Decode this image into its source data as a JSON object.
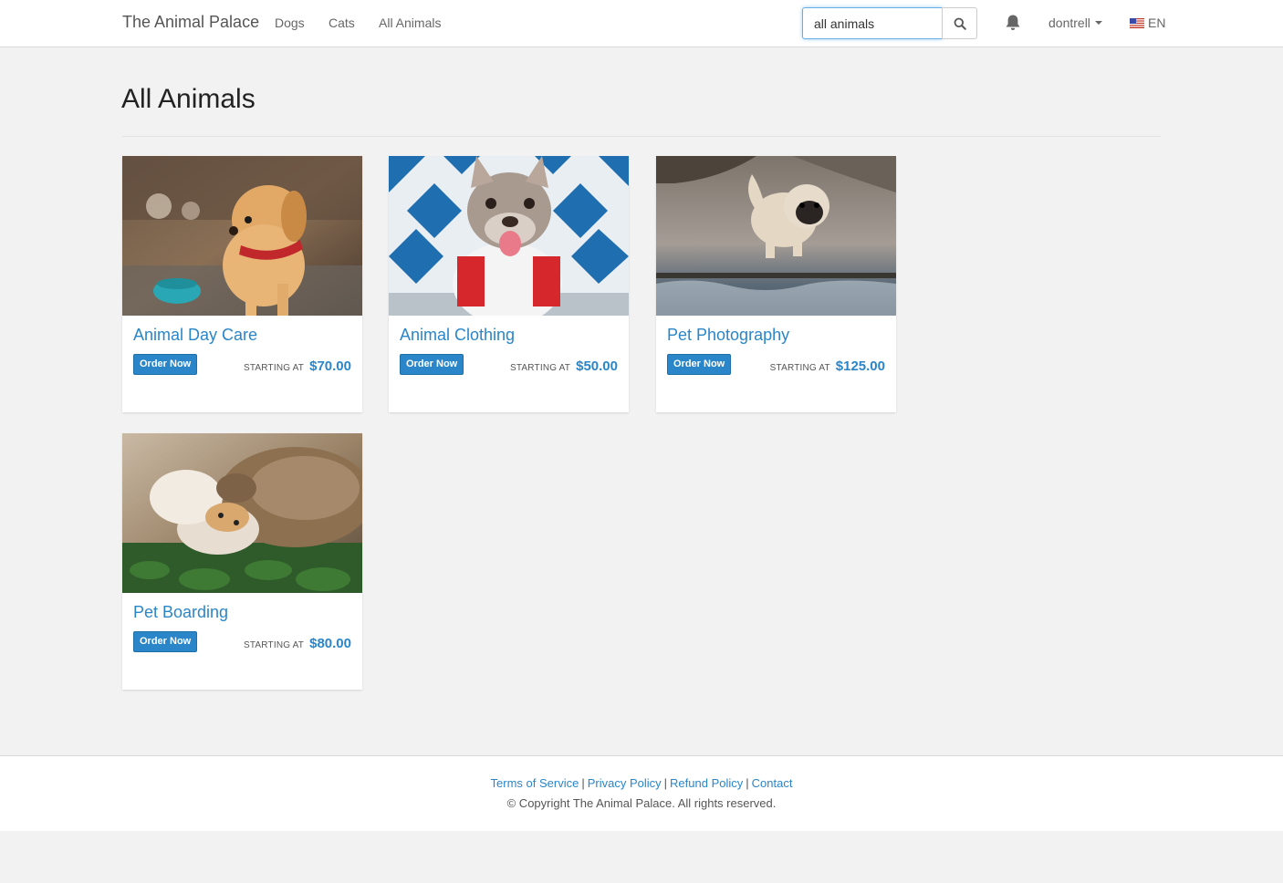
{
  "navbar": {
    "brand": "The Animal Palace",
    "links": [
      {
        "label": "Dogs"
      },
      {
        "label": "Cats"
      },
      {
        "label": "All Animals"
      }
    ],
    "search": {
      "value": "all animals",
      "icon": "search-icon"
    },
    "notifications_icon": "bell-icon",
    "user": {
      "name": "dontrell"
    },
    "language": {
      "code": "EN",
      "icon": "us-flag-icon"
    }
  },
  "main": {
    "title": "All Animals",
    "products": [
      {
        "name": "Animal Day Care",
        "button": "Order Now",
        "starting_label": "STARTING AT",
        "price": "$70.00",
        "image": "puppy-photo"
      },
      {
        "name": "Animal Clothing",
        "button": "Order Now",
        "starting_label": "STARTING AT",
        "price": "$50.00",
        "image": "bulldog-shirt-photo"
      },
      {
        "name": "Pet Photography",
        "button": "Order Now",
        "starting_label": "STARTING AT",
        "price": "$125.00",
        "image": "jumping-pug-photo"
      },
      {
        "name": "Pet Boarding",
        "button": "Order Now",
        "starting_label": "STARTING AT",
        "price": "$80.00",
        "image": "cat-and-dog-photo"
      }
    ]
  },
  "footer": {
    "links": [
      {
        "label": "Terms of Service"
      },
      {
        "label": "Privacy Policy"
      },
      {
        "label": "Refund Policy"
      },
      {
        "label": "Contact"
      }
    ],
    "separator": "|",
    "copyright": "© Copyright The Animal Palace. All rights reserved."
  },
  "colors": {
    "accent": "#2a86c8",
    "background": "#f2f2f2",
    "navbar": "#ffffff"
  }
}
